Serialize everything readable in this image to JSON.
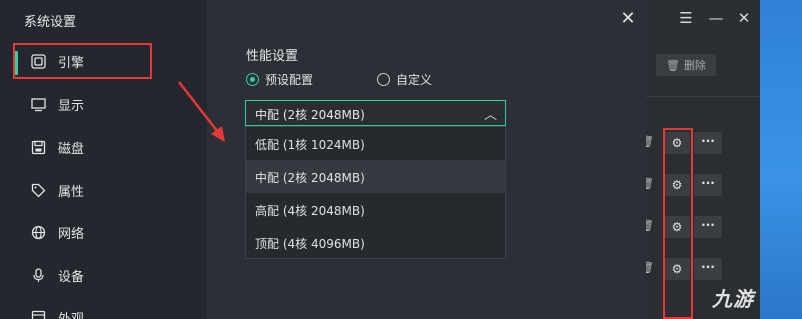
{
  "dialog": {
    "title": "系统设置",
    "sidebar": [
      {
        "label": "引擎",
        "icon": "engine-icon",
        "active": true
      },
      {
        "label": "显示",
        "icon": "monitor-icon"
      },
      {
        "label": "磁盘",
        "icon": "disk-icon"
      },
      {
        "label": "属性",
        "icon": "tag-icon"
      },
      {
        "label": "网络",
        "icon": "globe-icon"
      },
      {
        "label": "设备",
        "icon": "microphone-icon"
      },
      {
        "label": "外观",
        "icon": "appearance-icon"
      }
    ],
    "section_title": "性能设置",
    "radios": [
      {
        "label": "预设配置",
        "checked": true
      },
      {
        "label": "自定义",
        "checked": false
      }
    ],
    "select": {
      "value": "中配 (2核 2048MB)",
      "options": [
        "低配 (1核 1024MB)",
        "中配 (2核 2048MB)",
        "高配 (4核 2048MB)",
        "顶配 (4核 4096MB)"
      ],
      "selected_index": 1
    }
  },
  "background_app": {
    "delete_label": "删除"
  },
  "watermark": "九游",
  "colors": {
    "accent": "#2fd1a1",
    "highlight": "#e53935"
  }
}
